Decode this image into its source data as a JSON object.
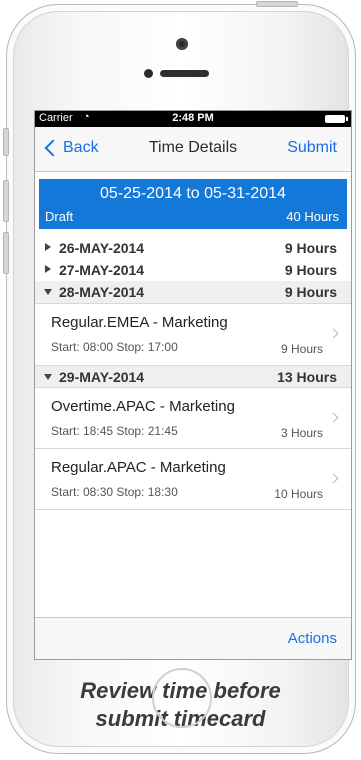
{
  "status_bar": {
    "carrier": "Carrier",
    "wifi_glyph": "◔",
    "time": "2:48 PM"
  },
  "nav": {
    "back_label": "Back",
    "title": "Time Details",
    "submit_label": "Submit"
  },
  "period": {
    "range": "05-25-2014 to 05-31-2014",
    "status": "Draft",
    "hours": "40 Hours"
  },
  "days": [
    {
      "date": "26-MAY-2014",
      "hours": "9 Hours",
      "expanded": false
    },
    {
      "date": "27-MAY-2014",
      "hours": "9 Hours",
      "expanded": false
    },
    {
      "date": "28-MAY-2014",
      "hours": "9 Hours",
      "expanded": true,
      "entries": [
        {
          "name": "Regular.EMEA - Marketing",
          "times": "Start: 08:00 Stop: 17:00",
          "hours": "9 Hours"
        }
      ]
    },
    {
      "date": "29-MAY-2014",
      "hours": "13 Hours",
      "expanded": true,
      "entries": [
        {
          "name": "Overtime.APAC - Marketing",
          "times": "Start: 18:45 Stop: 21:45",
          "hours": "3 Hours"
        },
        {
          "name": "Regular.APAC - Marketing",
          "times": "Start: 08:30 Stop: 18:30",
          "hours": "10 Hours"
        }
      ]
    }
  ],
  "toolbar": {
    "actions_label": "Actions"
  },
  "caption": {
    "line1": "Review time before",
    "line2": "submit timecard"
  }
}
